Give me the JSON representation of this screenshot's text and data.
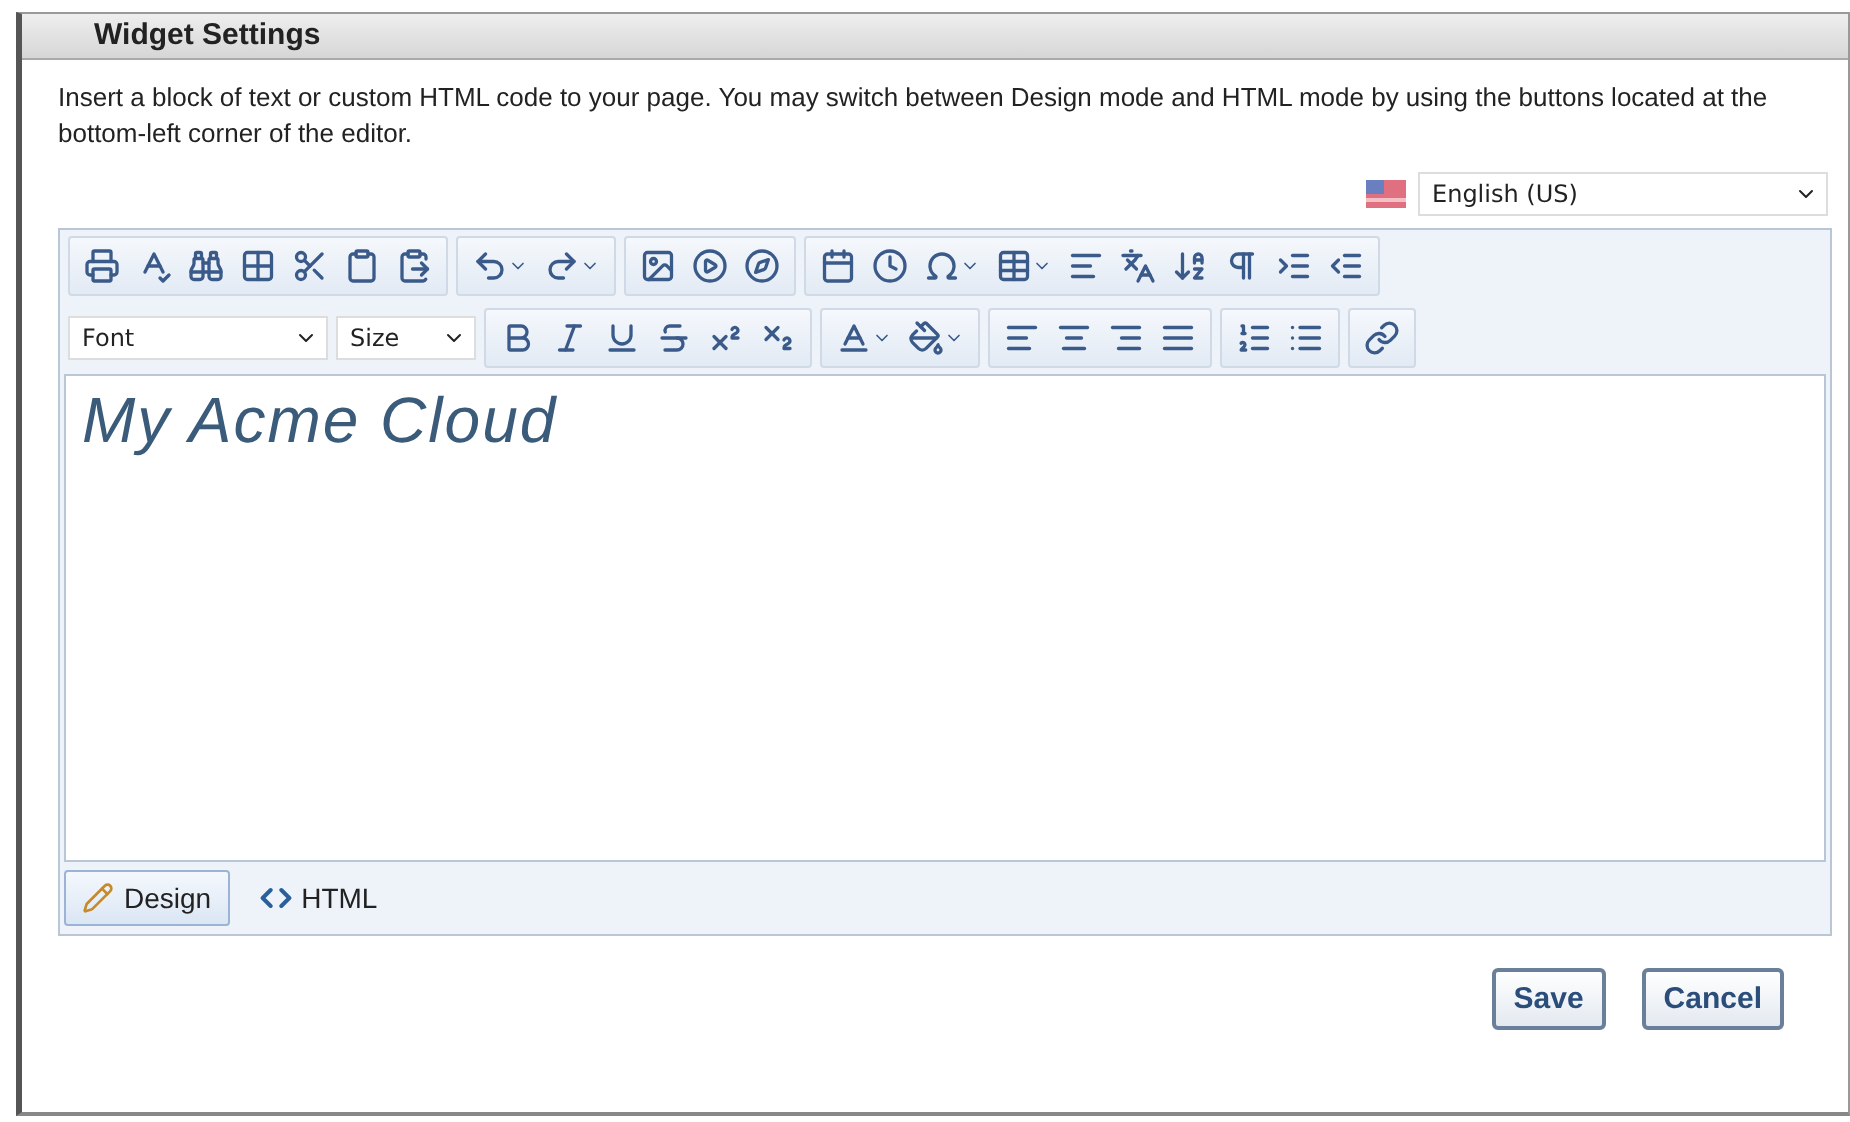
{
  "window": {
    "title": "Widget Settings"
  },
  "description": "Insert a block of text or custom HTML code to your page. You may switch between Design mode and HTML mode by using the buttons located at the bottom-left corner of the editor.",
  "language": {
    "value": "English (US)"
  },
  "editor": {
    "font": "Font",
    "size": "Size",
    "content": "My Acme Cloud"
  },
  "modes": [
    {
      "label": "Design",
      "kind": "design",
      "selected": true
    },
    {
      "label": "HTML",
      "kind": "html",
      "selected": false
    }
  ],
  "buttons": [
    "Save",
    "Cancel"
  ]
}
